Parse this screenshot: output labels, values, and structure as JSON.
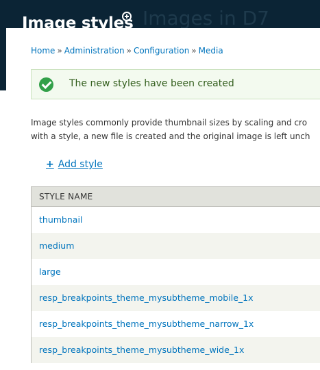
{
  "header": {
    "title": "Image styles",
    "background_title": "Images in D7",
    "shortcut_icon": "add-shortcut-icon"
  },
  "breadcrumb": {
    "items": [
      "Home",
      "Administration",
      "Configuration",
      "Media"
    ],
    "separator": "»"
  },
  "status": {
    "icon": "check-circle-icon",
    "message": "The new styles have been created"
  },
  "description": {
    "line1": "Image styles commonly provide thumbnail sizes by scaling and cro",
    "line2": "with a style, a new file is created and the original image is left unch"
  },
  "actions": {
    "add_style": "Add style"
  },
  "table": {
    "header": "STYLE NAME",
    "rows": [
      "thumbnail",
      "medium",
      "large",
      "resp_breakpoints_theme_mysubtheme_mobile_1x",
      "resp_breakpoints_theme_mysubtheme_narrow_1x",
      "resp_breakpoints_theme_mysubtheme_wide_1x"
    ]
  },
  "colors": {
    "header_bg": "#0b2435",
    "link": "#0074bd",
    "status_bg": "#f3faef",
    "status_border": "#c9e1bd",
    "success_icon": "#32a049",
    "table_header_bg": "#e1e2dc",
    "row_alt_bg": "#f3f4ee"
  }
}
